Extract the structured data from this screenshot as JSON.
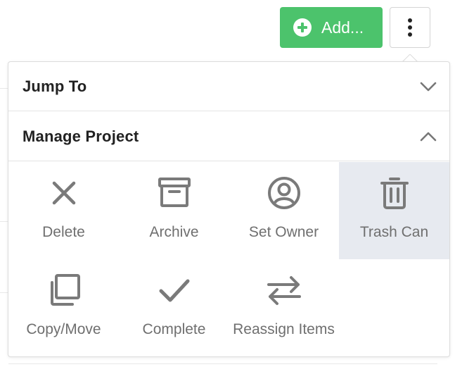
{
  "toolbar": {
    "add_label": "Add...",
    "add_color": "#4cc36c"
  },
  "menu": {
    "sections": [
      {
        "title": "Jump To",
        "expanded": false,
        "icon": "chevron-down-icon"
      },
      {
        "title": "Manage Project",
        "expanded": true,
        "icon": "chevron-up-icon"
      }
    ],
    "actions": [
      {
        "label": "Delete",
        "icon": "close-icon",
        "active": false
      },
      {
        "label": "Archive",
        "icon": "archive-box-icon",
        "active": false
      },
      {
        "label": "Set Owner",
        "icon": "user-circle-icon",
        "active": false
      },
      {
        "label": "Trash Can",
        "icon": "trash-icon",
        "active": true
      },
      {
        "label": "Copy/Move",
        "icon": "copy-icon",
        "active": false
      },
      {
        "label": "Complete",
        "icon": "checkmark-icon",
        "active": false
      },
      {
        "label": "Reassign Items",
        "icon": "swap-arrows-icon",
        "active": false
      }
    ]
  },
  "colors": {
    "icon_gray": "#7a7a7a",
    "active_tile_bg": "#e7eaf0"
  }
}
